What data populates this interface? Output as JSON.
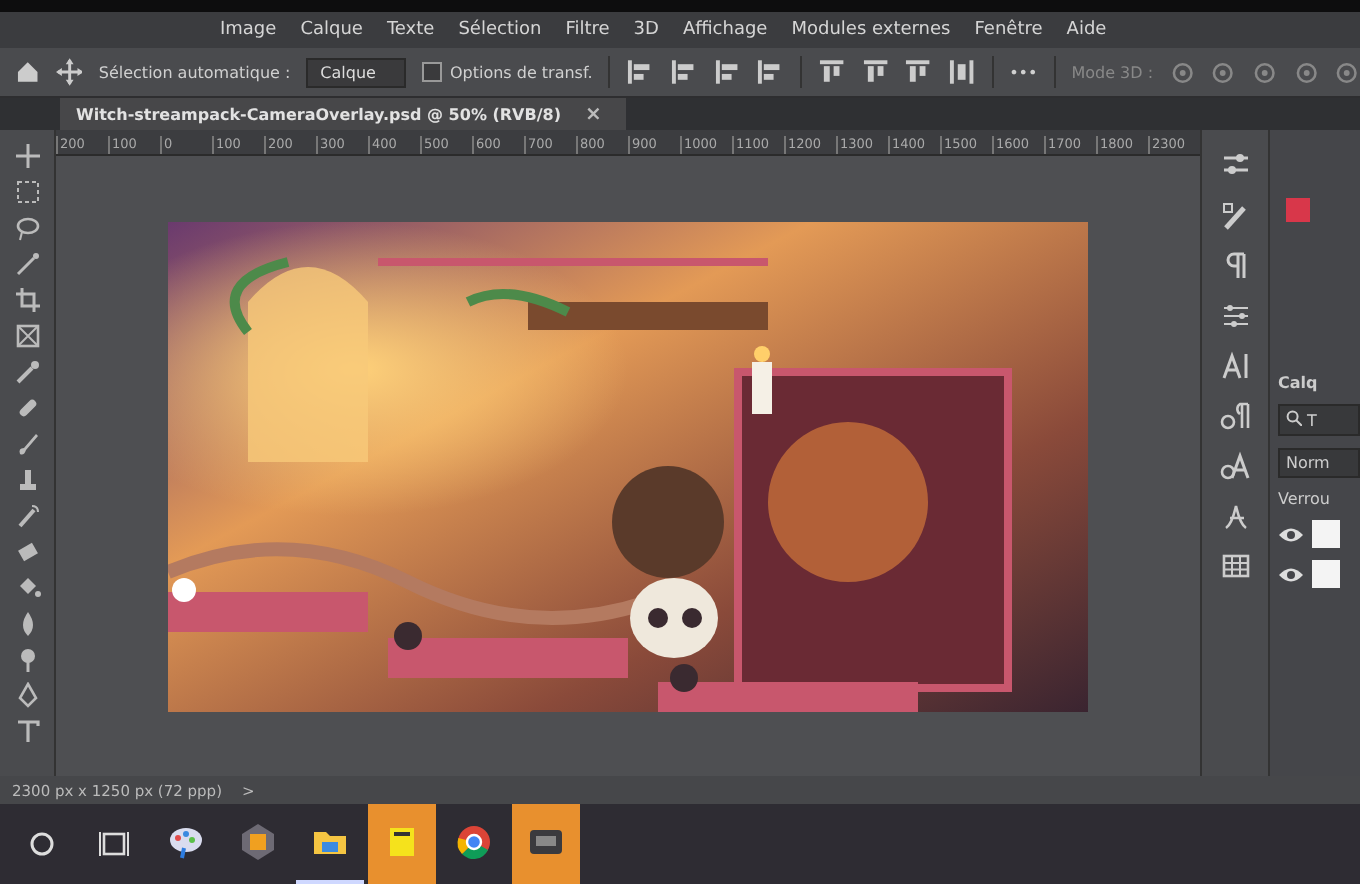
{
  "menu": [
    "Image",
    "Calque",
    "Texte",
    "Sélection",
    "Filtre",
    "3D",
    "Affichage",
    "Modules externes",
    "Fenêtre",
    "Aide"
  ],
  "options": {
    "auto_select_label": "Sélection automatique :",
    "auto_select_value": "Calque",
    "transform_checked": false,
    "transform_label": "Options de transf.",
    "more": "•••",
    "mode_3d": "Mode 3D :"
  },
  "document_tab": {
    "title": "Witch-streampack-CameraOverlay.psd @ 50% (RVB/8)",
    "close": "×"
  },
  "ruler": [
    "200",
    "100",
    "0",
    "100",
    "200",
    "300",
    "400",
    "500",
    "600",
    "700",
    "800",
    "900",
    "1000",
    "1100",
    "1200",
    "1300",
    "1400",
    "1500",
    "1600",
    "1700",
    "1800",
    "2300"
  ],
  "layers_panel": {
    "title": "Calq",
    "search": "T",
    "blend_mode": "Norm",
    "lock_label": "Verrou",
    "layers": [
      {
        "visible": true
      },
      {
        "visible": true
      }
    ]
  },
  "status_bar": {
    "size": "2300 px x 1250 px (72 ppp)",
    "arrow": ">"
  },
  "taskbar": {
    "apps": [
      {
        "kind": "paint",
        "running": false,
        "highlighted": false
      },
      {
        "kind": "game",
        "running": false,
        "highlighted": false
      },
      {
        "kind": "folder",
        "running": true,
        "highlighted": false
      },
      {
        "kind": "notes",
        "running": false,
        "highlighted": true
      },
      {
        "kind": "browser",
        "running": false,
        "highlighted": false
      },
      {
        "kind": "stream",
        "running": false,
        "highlighted": true
      }
    ]
  }
}
